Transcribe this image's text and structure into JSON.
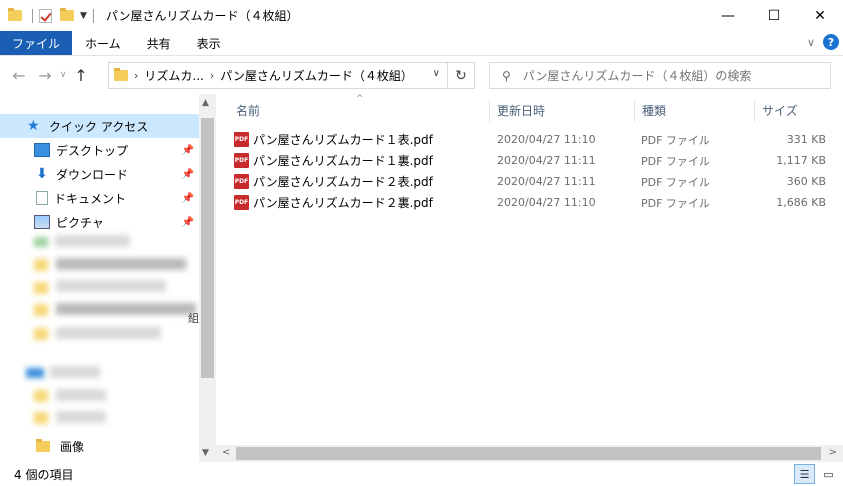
{
  "window": {
    "title": "パン屋さんリズムカード（４枚組）",
    "minimize": "—",
    "maximize": "☐",
    "close": "✕"
  },
  "ribbon": {
    "tabs": [
      "ファイル",
      "ホーム",
      "共有",
      "表示"
    ],
    "expand": "∨",
    "help": "?"
  },
  "nav": {
    "back": "←",
    "forward": "→",
    "recent": "∨",
    "up": "↑",
    "breadcrumbs": [
      "リズムカ...",
      "パン屋さんリズムカード（４枚組）"
    ],
    "refresh": "↻",
    "search_placeholder": "パン屋さんリズムカード（４枚組）の検索"
  },
  "sidebar": {
    "items": [
      {
        "label": "クイック アクセス",
        "icon": "star-icon",
        "selected": true
      },
      {
        "label": "デスクトップ",
        "icon": "desktop-icon",
        "pinned": true
      },
      {
        "label": "ダウンロード",
        "icon": "download-icon",
        "pinned": true
      },
      {
        "label": "ドキュメント",
        "icon": "document-icon",
        "pinned": true
      },
      {
        "label": "ピクチャ",
        "icon": "pictures-icon",
        "pinned": true
      }
    ],
    "bottom_item": {
      "label": "画像",
      "icon": "folder-icon"
    },
    "blurred_tail": "組"
  },
  "columns": {
    "name": "名前",
    "date": "更新日時",
    "type": "種類",
    "size": "サイズ"
  },
  "files": [
    {
      "name": "パン屋さんリズムカード１表.pdf",
      "date": "2020/04/27 11:10",
      "type": "PDF ファイル",
      "size": "331 KB"
    },
    {
      "name": "パン屋さんリズムカード１裏.pdf",
      "date": "2020/04/27 11:11",
      "type": "PDF ファイル",
      "size": "1,117 KB"
    },
    {
      "name": "パン屋さんリズムカード２表.pdf",
      "date": "2020/04/27 11:11",
      "type": "PDF ファイル",
      "size": "360 KB"
    },
    {
      "name": "パン屋さんリズムカード２裏.pdf",
      "date": "2020/04/27 11:10",
      "type": "PDF ファイル",
      "size": "1,686 KB"
    }
  ],
  "pdf_icon_text": "PDF",
  "status": {
    "count": "4 個の項目"
  },
  "colors": {
    "file_tab": "#1a5fb4",
    "selected": "#cce8ff",
    "header_text": "#4c607a"
  }
}
